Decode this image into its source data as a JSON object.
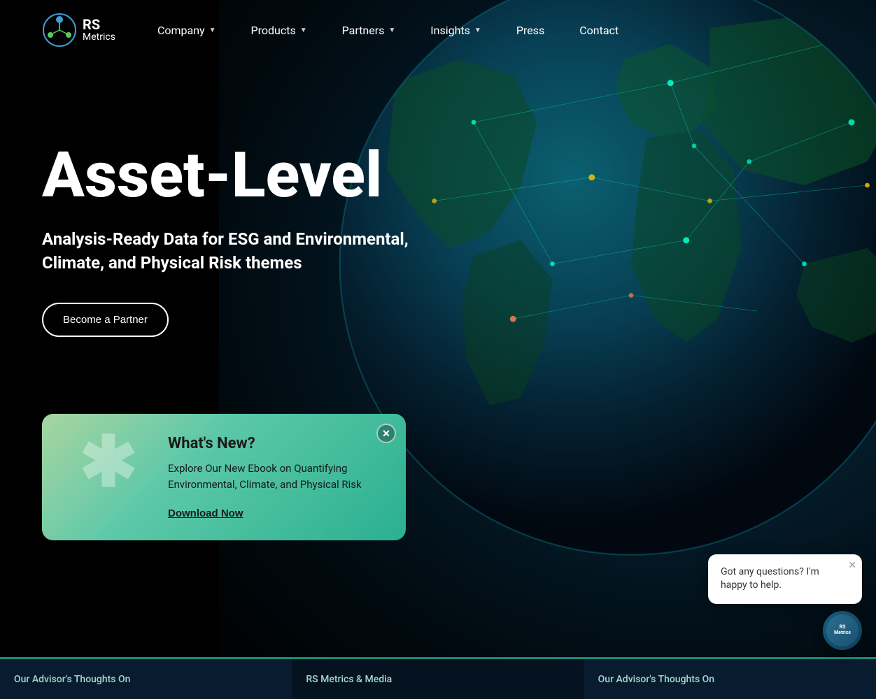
{
  "logo": {
    "rs": "RS",
    "metrics": "Metrics"
  },
  "nav": {
    "items": [
      {
        "label": "Company",
        "hasDropdown": true
      },
      {
        "label": "Products",
        "hasDropdown": true
      },
      {
        "label": "Partners",
        "hasDropdown": true
      },
      {
        "label": "Insights",
        "hasDropdown": true
      },
      {
        "label": "Press",
        "hasDropdown": false
      },
      {
        "label": "Contact",
        "hasDropdown": false
      }
    ]
  },
  "hero": {
    "title": "Asset-Level",
    "subtitle": "Analysis-Ready Data for ESG and Environmental, Climate, and Physical Risk themes",
    "cta_label": "Become a Partner"
  },
  "popup": {
    "close_icon": "✕",
    "asterisk": "✱",
    "title": "What's New?",
    "description": "Explore Our New Ebook on Quantifying Environmental, Climate, and Physical Risk",
    "download_label": "Download Now"
  },
  "bottom_cards": [
    {
      "text": "Our Advisor's Thoughts On"
    },
    {
      "text": "RS Metrics & Media"
    },
    {
      "text": "Our Advisor's Thoughts On"
    }
  ],
  "chat": {
    "bubble_text": "Got any questions? I'm happy to help.",
    "logo_line1": "RS",
    "logo_line2": "Metrics",
    "close_icon": "✕"
  }
}
